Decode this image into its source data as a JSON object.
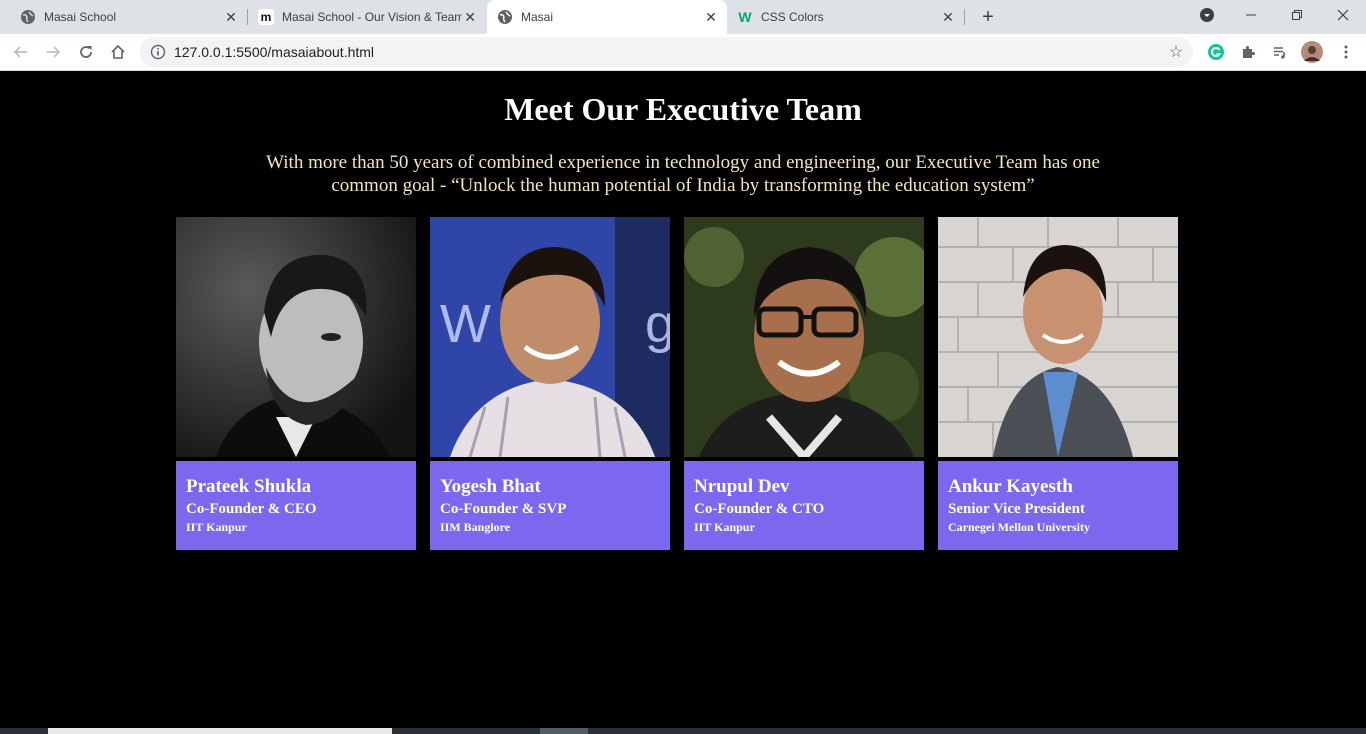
{
  "tabs": [
    {
      "title": "Masai School",
      "icon": "globe-icon",
      "active": false
    },
    {
      "title": "Masai School - Our Vision & Team",
      "icon": "masai-m-icon",
      "active": false
    },
    {
      "title": "Masai",
      "icon": "globe-icon",
      "active": true
    },
    {
      "title": "CSS Colors",
      "icon": "w3schools-icon",
      "active": false
    }
  ],
  "toolbar": {
    "url": "127.0.0.1:5500/masaiabout.html"
  },
  "page": {
    "heading": "Meet Our Executive Team",
    "subtitle": "With more than 50 years of combined experience in technology and engineering, our Executive Team has one common goal - “Unlock the human potential of India by transforming the education system”",
    "accent_color": "#7b68ee",
    "team": [
      {
        "name": "Prateek Shukla",
        "role": "Co-Founder & CEO",
        "education": "IIT Kanpur"
      },
      {
        "name": "Yogesh Bhat",
        "role": "Co-Founder & SVP",
        "education": "IIM Banglore"
      },
      {
        "name": "Nrupul Dev",
        "role": "Co-Founder & CTO",
        "education": "IIT Kanpur"
      },
      {
        "name": "Ankur Kayesth",
        "role": "Senior Vice President",
        "education": "Carnegei Mellon University"
      }
    ]
  }
}
